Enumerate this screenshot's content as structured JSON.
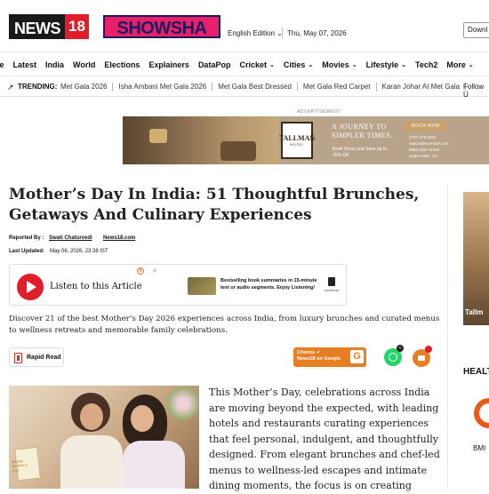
{
  "header": {
    "logo_text": "NEWS",
    "logo_number": "18",
    "showsha_logo": "SHOWSHA",
    "edition": "English Edition ⌄",
    "date": "Thu, May 07, 2026",
    "download_label": "Downl"
  },
  "nav": {
    "items": [
      {
        "label": "ne",
        "chevron": ""
      },
      {
        "label": "Latest",
        "chevron": ""
      },
      {
        "label": "India",
        "chevron": ""
      },
      {
        "label": "World",
        "chevron": ""
      },
      {
        "label": "Elections",
        "chevron": ""
      },
      {
        "label": "Explainers",
        "chevron": ""
      },
      {
        "label": "DataPop",
        "chevron": ""
      },
      {
        "label": "Cricket",
        "chevron": "⌄"
      },
      {
        "label": "Cities",
        "chevron": "⌄"
      },
      {
        "label": "Movies",
        "chevron": "⌄"
      },
      {
        "label": "Lifestyle",
        "chevron": "⌄"
      },
      {
        "label": "Tech2",
        "chevron": ""
      },
      {
        "label": "More",
        "chevron": "⌄"
      }
    ]
  },
  "trending": {
    "icon": "↗",
    "label": "TRENDING:",
    "items": [
      "Met Gala 2026",
      "Isha Ambani Met Gala 2026",
      "Met Gala Best Dressed",
      "Met Gala Red Carpet",
      "Karan Johar At Met Gala"
    ],
    "follow": "Follow U"
  },
  "ad": {
    "label": "ADVERTISEMENT",
    "logo_name": "TALLMAN",
    "logo_sub": "HOTEL",
    "headline": "A JOURNEY TO SIMPLER TIMES.",
    "body": "Book Direct and Save up to 25% Off",
    "book_button": "BOOK NOW",
    "contact": "(707) 275-2244\nwww.tallmanhotel.com\n9550 Main Street\nUpper Lake, CA"
  },
  "sidebar": {
    "ad_text": "Tallm",
    "heading": "HEALT",
    "label": "BMI"
  },
  "article": {
    "title": "Mother’s Day In India: 51 Thoughtful Brunches, Getaways And Culinary Experiences",
    "reported_by_label": "Reported By :",
    "author": "Swati Chaturvedi",
    "source": "News18.com",
    "updated_label": "Last Updated:",
    "updated_value": "May 06, 2026, 23:38 IST",
    "summary": "Discover 21 of the best Mother’s Day 2026 experiences across India, from luxury brunches and curated menus to wellness retreats and memorable family celebrations.",
    "body": "This Mother’s Day, celebrations across India are moving beyond the expected, with leading hotels and restaurants curating experiences that feel personal, indulgent, and thoughtfully designed. From elegant brunches and chef-led menus to wellness-led escapes and intimate dining moments, the focus is on creating",
    "hero_card_text": "Happy Mother's Day"
  },
  "listen": {
    "label": "Listen to this Article",
    "promo": "Bestselling book summaries in 15-minute text or audio segments. Enjoy Listening!",
    "brand": "Instaread",
    "ad_icon": "⊕",
    "close": "✕"
  },
  "actions": {
    "rapid_read": "Rapid Read",
    "google_text": "Choose ✓\nNews18 on Google",
    "google_letter": "G",
    "share_glyph": "<"
  }
}
